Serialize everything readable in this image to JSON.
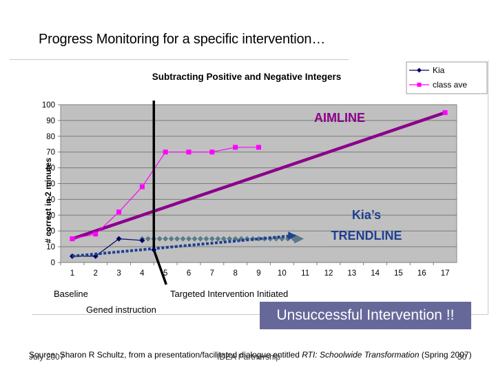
{
  "slide": {
    "title": "Progress Monitoring for a specific intervention…"
  },
  "annotations": {
    "aimline": "AIMLINE",
    "trendline_line1": "Kia’s",
    "trendline_line2": "TRENDLINE",
    "baseline": "Baseline",
    "gened": "Gened instruction",
    "targeted": "Targeted Intervention Initiated",
    "banner": "Unsuccessful Intervention !!"
  },
  "footer": {
    "source_prefix": "Source: Sharon R Schultz, from a presentation/facilitated dialogue entitled ",
    "source_title": "RTI: Schoolwide Transformation",
    "source_suffix": " (Spring 2007)",
    "date": "July 2007",
    "org": "IDEA Partnership",
    "page": "30"
  },
  "colors": {
    "kia": "#000066",
    "class_ave": "#ff00ff",
    "aimline": "#8b008b",
    "trendline": "#1f3f8f",
    "projection": "#5a7a8a",
    "plot_bg": "#c0c0c0",
    "banner_bg": "#67689a"
  },
  "chart_data": {
    "type": "line",
    "title": "Subtracting Positive and Negative Integers",
    "xlabel": "",
    "ylabel": "# correct in 2 minutes",
    "x_categories": [
      "1",
      "2",
      "3",
      "4",
      "5",
      "6",
      "7",
      "8",
      "9",
      "10",
      "11",
      "12",
      "13",
      "14",
      "15",
      "16",
      "17"
    ],
    "ylim": [
      0,
      100
    ],
    "yticks": [
      0,
      10,
      20,
      30,
      40,
      50,
      60,
      70,
      80,
      90,
      100
    ],
    "grid": true,
    "legend_position": "top-right",
    "series": [
      {
        "name": "Kia",
        "marker": "diamond",
        "points": [
          [
            1,
            4
          ],
          [
            2,
            4
          ],
          [
            3,
            15
          ],
          [
            4,
            14
          ],
          [
            5,
            8
          ]
        ]
      },
      {
        "name": "class ave",
        "marker": "square",
        "points": [
          [
            1,
            15
          ],
          [
            2,
            18
          ],
          [
            3,
            32
          ],
          [
            4,
            48
          ],
          [
            5,
            70
          ],
          [
            6,
            70
          ],
          [
            7,
            70
          ],
          [
            8,
            73
          ],
          [
            9,
            73
          ],
          [
            17,
            95
          ]
        ]
      }
    ],
    "aimline": {
      "label": "AIMLINE",
      "from": [
        1,
        15
      ],
      "to": [
        17,
        95
      ]
    },
    "trendline": {
      "label": "Kia's TRENDLINE",
      "from": [
        1,
        4
      ],
      "to": [
        10.5,
        17
      ]
    },
    "projection": {
      "from": [
        4,
        15
      ],
      "to": [
        11,
        15
      ]
    },
    "phase_change_x": 4.5
  }
}
